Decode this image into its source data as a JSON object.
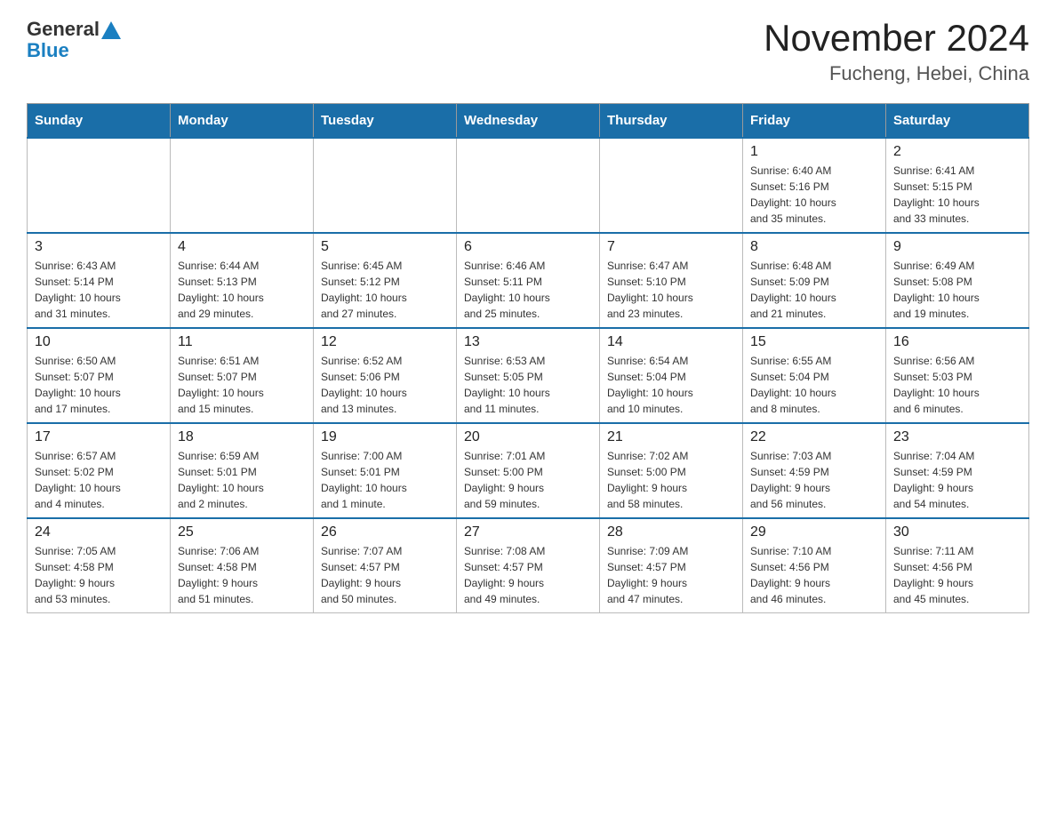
{
  "logo": {
    "general": "General",
    "blue": "Blue",
    "triangle_color": "#1a7fc1"
  },
  "title": "November 2024",
  "subtitle": "Fucheng, Hebei, China",
  "header_color": "#1a6ea8",
  "days_of_week": [
    "Sunday",
    "Monday",
    "Tuesday",
    "Wednesday",
    "Thursday",
    "Friday",
    "Saturday"
  ],
  "weeks": [
    [
      {
        "day": "",
        "info": ""
      },
      {
        "day": "",
        "info": ""
      },
      {
        "day": "",
        "info": ""
      },
      {
        "day": "",
        "info": ""
      },
      {
        "day": "",
        "info": ""
      },
      {
        "day": "1",
        "info": "Sunrise: 6:40 AM\nSunset: 5:16 PM\nDaylight: 10 hours\nand 35 minutes."
      },
      {
        "day": "2",
        "info": "Sunrise: 6:41 AM\nSunset: 5:15 PM\nDaylight: 10 hours\nand 33 minutes."
      }
    ],
    [
      {
        "day": "3",
        "info": "Sunrise: 6:43 AM\nSunset: 5:14 PM\nDaylight: 10 hours\nand 31 minutes."
      },
      {
        "day": "4",
        "info": "Sunrise: 6:44 AM\nSunset: 5:13 PM\nDaylight: 10 hours\nand 29 minutes."
      },
      {
        "day": "5",
        "info": "Sunrise: 6:45 AM\nSunset: 5:12 PM\nDaylight: 10 hours\nand 27 minutes."
      },
      {
        "day": "6",
        "info": "Sunrise: 6:46 AM\nSunset: 5:11 PM\nDaylight: 10 hours\nand 25 minutes."
      },
      {
        "day": "7",
        "info": "Sunrise: 6:47 AM\nSunset: 5:10 PM\nDaylight: 10 hours\nand 23 minutes."
      },
      {
        "day": "8",
        "info": "Sunrise: 6:48 AM\nSunset: 5:09 PM\nDaylight: 10 hours\nand 21 minutes."
      },
      {
        "day": "9",
        "info": "Sunrise: 6:49 AM\nSunset: 5:08 PM\nDaylight: 10 hours\nand 19 minutes."
      }
    ],
    [
      {
        "day": "10",
        "info": "Sunrise: 6:50 AM\nSunset: 5:07 PM\nDaylight: 10 hours\nand 17 minutes."
      },
      {
        "day": "11",
        "info": "Sunrise: 6:51 AM\nSunset: 5:07 PM\nDaylight: 10 hours\nand 15 minutes."
      },
      {
        "day": "12",
        "info": "Sunrise: 6:52 AM\nSunset: 5:06 PM\nDaylight: 10 hours\nand 13 minutes."
      },
      {
        "day": "13",
        "info": "Sunrise: 6:53 AM\nSunset: 5:05 PM\nDaylight: 10 hours\nand 11 minutes."
      },
      {
        "day": "14",
        "info": "Sunrise: 6:54 AM\nSunset: 5:04 PM\nDaylight: 10 hours\nand 10 minutes."
      },
      {
        "day": "15",
        "info": "Sunrise: 6:55 AM\nSunset: 5:04 PM\nDaylight: 10 hours\nand 8 minutes."
      },
      {
        "day": "16",
        "info": "Sunrise: 6:56 AM\nSunset: 5:03 PM\nDaylight: 10 hours\nand 6 minutes."
      }
    ],
    [
      {
        "day": "17",
        "info": "Sunrise: 6:57 AM\nSunset: 5:02 PM\nDaylight: 10 hours\nand 4 minutes."
      },
      {
        "day": "18",
        "info": "Sunrise: 6:59 AM\nSunset: 5:01 PM\nDaylight: 10 hours\nand 2 minutes."
      },
      {
        "day": "19",
        "info": "Sunrise: 7:00 AM\nSunset: 5:01 PM\nDaylight: 10 hours\nand 1 minute."
      },
      {
        "day": "20",
        "info": "Sunrise: 7:01 AM\nSunset: 5:00 PM\nDaylight: 9 hours\nand 59 minutes."
      },
      {
        "day": "21",
        "info": "Sunrise: 7:02 AM\nSunset: 5:00 PM\nDaylight: 9 hours\nand 58 minutes."
      },
      {
        "day": "22",
        "info": "Sunrise: 7:03 AM\nSunset: 4:59 PM\nDaylight: 9 hours\nand 56 minutes."
      },
      {
        "day": "23",
        "info": "Sunrise: 7:04 AM\nSunset: 4:59 PM\nDaylight: 9 hours\nand 54 minutes."
      }
    ],
    [
      {
        "day": "24",
        "info": "Sunrise: 7:05 AM\nSunset: 4:58 PM\nDaylight: 9 hours\nand 53 minutes."
      },
      {
        "day": "25",
        "info": "Sunrise: 7:06 AM\nSunset: 4:58 PM\nDaylight: 9 hours\nand 51 minutes."
      },
      {
        "day": "26",
        "info": "Sunrise: 7:07 AM\nSunset: 4:57 PM\nDaylight: 9 hours\nand 50 minutes."
      },
      {
        "day": "27",
        "info": "Sunrise: 7:08 AM\nSunset: 4:57 PM\nDaylight: 9 hours\nand 49 minutes."
      },
      {
        "day": "28",
        "info": "Sunrise: 7:09 AM\nSunset: 4:57 PM\nDaylight: 9 hours\nand 47 minutes."
      },
      {
        "day": "29",
        "info": "Sunrise: 7:10 AM\nSunset: 4:56 PM\nDaylight: 9 hours\nand 46 minutes."
      },
      {
        "day": "30",
        "info": "Sunrise: 7:11 AM\nSunset: 4:56 PM\nDaylight: 9 hours\nand 45 minutes."
      }
    ]
  ]
}
